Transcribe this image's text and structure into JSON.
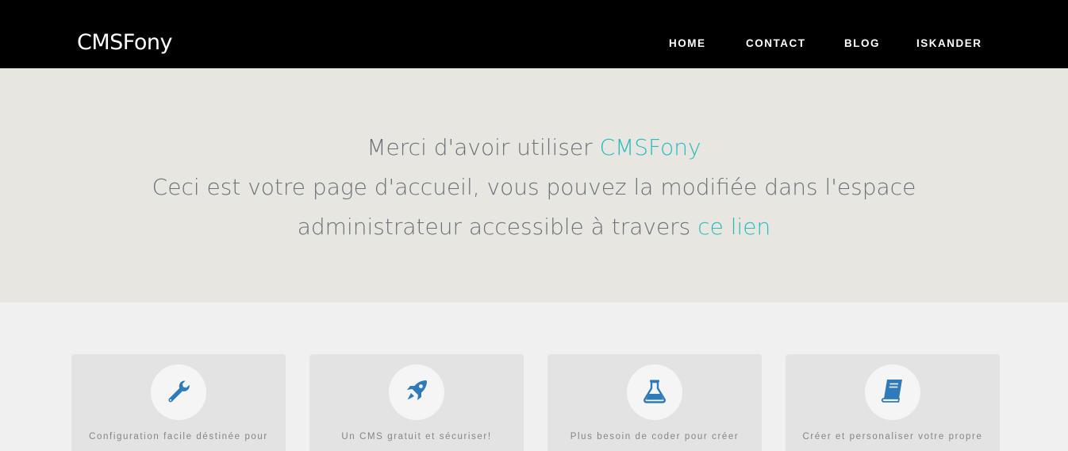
{
  "navbar": {
    "brand": "CMSFony",
    "links": [
      {
        "label": "HOME"
      },
      {
        "label": "CONTACT"
      },
      {
        "label": "BLOG"
      },
      {
        "label": "ISKANDER"
      }
    ]
  },
  "hero": {
    "line1_prefix": "Merci d'avoir utiliser ",
    "line1_accent": "CMSFony",
    "line2": "Ceci est votre page d'accueil, vous pouvez la modifiée dans l'espace",
    "line3_prefix": "administrateur accessible à travers ",
    "line3_link": "ce lien"
  },
  "features": [
    {
      "icon": "wrench-icon",
      "text": "Configuration facile déstinée pour"
    },
    {
      "icon": "rocket-icon",
      "text": "Un CMS gratuit et sécuriser!"
    },
    {
      "icon": "flask-icon",
      "text": "Plus besoin de coder pour créer"
    },
    {
      "icon": "book-icon",
      "text": "Créer et personaliser votre propre"
    }
  ],
  "colors": {
    "navbar_bg": "#000000",
    "accent": "#2bbbbf",
    "icon": "#2f7ab9",
    "hero_bg": "#e8e6e1",
    "card_bg": "#e4e3e3"
  }
}
